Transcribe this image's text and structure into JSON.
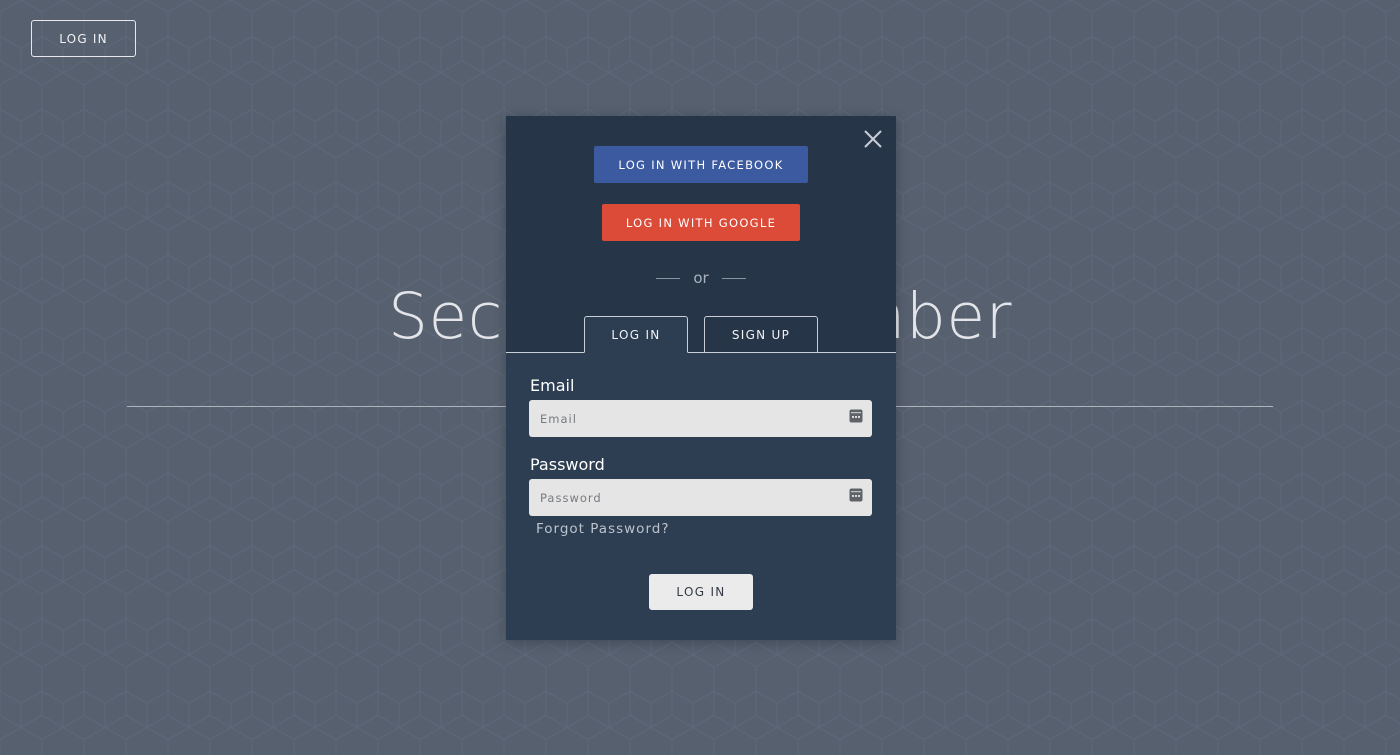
{
  "header": {
    "login_label": "LOG IN"
  },
  "hero": {
    "title": "Sector Sub Number"
  },
  "modal": {
    "close_icon": "close-icon",
    "facebook_label": "LOG IN WITH FACEBOOK",
    "google_label": "LOG IN WITH GOOGLE",
    "or_text": "or",
    "tabs": [
      {
        "label": "LOG IN",
        "active": true
      },
      {
        "label": "SIGN UP",
        "active": false
      }
    ],
    "email": {
      "label": "Email",
      "placeholder": "Email",
      "value": "",
      "icon": "password-manager-icon"
    },
    "password": {
      "label": "Password",
      "placeholder": "Password",
      "value": "",
      "icon": "password-manager-icon"
    },
    "forgot_label": "Forgot Password?",
    "submit_label": "LOG IN"
  },
  "colors": {
    "background": "#56606f",
    "modal": "#2d3d52",
    "modal_top": "#263548",
    "facebook": "#3b5aa0",
    "google": "#dc4a38",
    "field": "#e5e5e5"
  }
}
